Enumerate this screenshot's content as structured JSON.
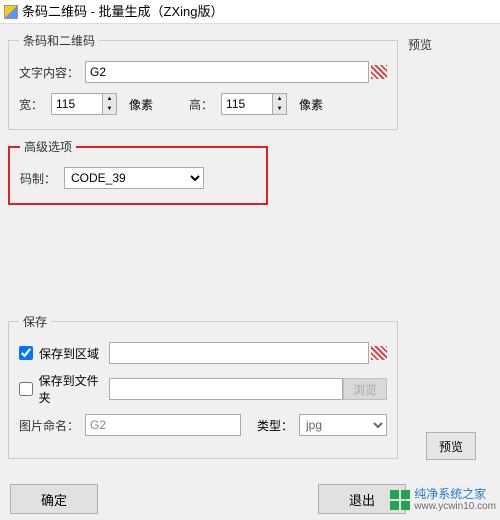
{
  "window": {
    "title": "条码二维码 - 批量生成（ZXing版）"
  },
  "group_main": {
    "legend": "条码和二维码",
    "text_label": "文字内容：",
    "text_value": "G2",
    "width_label": "宽：",
    "width_value": "115",
    "height_label": "高：",
    "height_value": "115",
    "unit": "像素"
  },
  "group_advanced": {
    "legend": "高级选项",
    "code_label": "码制：",
    "code_value": "CODE_39"
  },
  "preview": {
    "legend": "预览",
    "button": "预览"
  },
  "group_save": {
    "legend": "保存",
    "to_region_label": "保存到区域",
    "to_region_checked": true,
    "to_region_value": "",
    "to_folder_label": "保存到文件夹",
    "to_folder_checked": false,
    "to_folder_value": "",
    "browse": "浏览",
    "name_label": "图片命名：",
    "name_value": "G2",
    "type_label": "类型：",
    "type_value": "jpg"
  },
  "buttons": {
    "ok": "确定",
    "cancel": "退出"
  },
  "watermark": {
    "name": "纯净系统之家",
    "url": "www.ycwin10.com"
  }
}
